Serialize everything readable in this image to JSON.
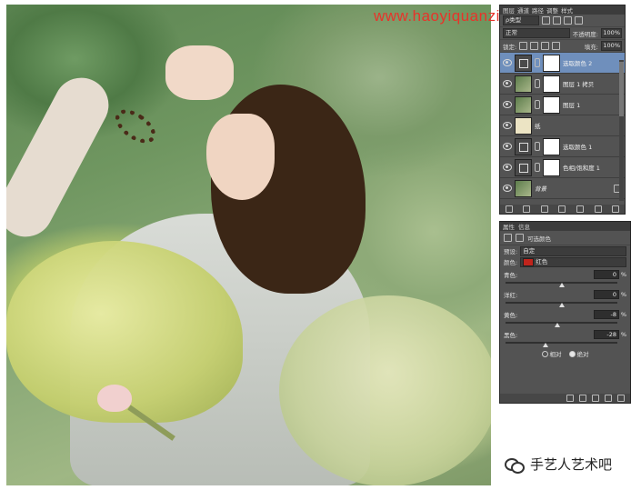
{
  "watermark": "www.haoyiquanziyouxuan.com",
  "wechat": {
    "name": "手艺人艺术吧"
  },
  "layers_panel": {
    "tabs": [
      "图层",
      "通道",
      "路径",
      "调整",
      "样式"
    ],
    "filter_label": "ρ类型",
    "blend_mode": "正常",
    "opacity_label": "不透明度:",
    "opacity_value": "100%",
    "lock_label": "锁定:",
    "fill_label": "填充:",
    "fill_value": "100%",
    "layers": [
      {
        "name": "选取颜色 2",
        "type": "adjustment",
        "selected": true
      },
      {
        "name": "图层 1 拷贝",
        "type": "photo",
        "selected": false
      },
      {
        "name": "图层 1",
        "type": "photo",
        "selected": false
      },
      {
        "name": "纸",
        "type": "paper",
        "selected": false
      },
      {
        "name": "选取颜色 1",
        "type": "adjustment",
        "selected": false
      },
      {
        "name": "色相/饱和度 1",
        "type": "adjustment",
        "selected": false
      },
      {
        "name": "背景",
        "type": "background",
        "selected": false
      }
    ]
  },
  "properties_panel": {
    "tabs": [
      "属性",
      "信息"
    ],
    "title": "可选颜色",
    "preset_label": "预设:",
    "preset_value": "自定",
    "colors_label": "颜色:",
    "colors_value": "红色",
    "colors_swatch": "#c0241c",
    "sliders": [
      {
        "label": "青色:",
        "value": "0",
        "unit": "%",
        "level": 0
      },
      {
        "label": "洋红:",
        "value": "0",
        "unit": "%",
        "level": 0
      },
      {
        "label": "黄色:",
        "value": "-8",
        "unit": "%",
        "level": -8
      },
      {
        "label": "黑色:",
        "value": "-28",
        "unit": "%",
        "level": -28
      }
    ],
    "method_relative": "相对",
    "method_absolute": "绝对",
    "method_selected": "absolute"
  },
  "colors": {
    "panel_bg": "#535353",
    "selected_layer": "#6f8fbc",
    "watermark": "#e8332a"
  }
}
